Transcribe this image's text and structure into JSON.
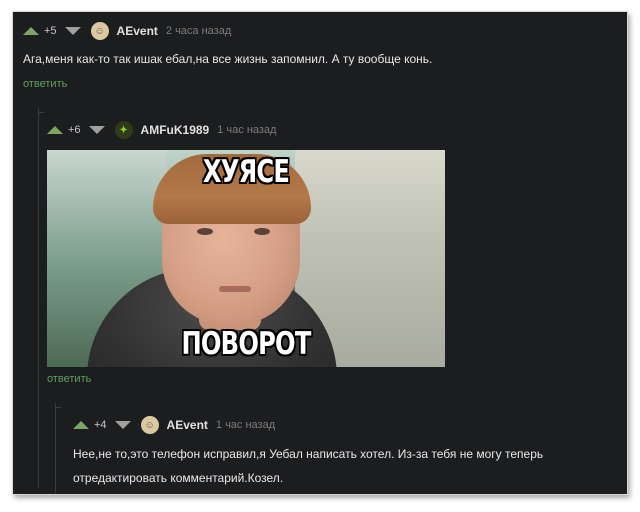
{
  "comments": [
    {
      "score": "+5",
      "author": "AEvent",
      "time": "2 часа назад",
      "text": "Ага,меня как-то так ишак ебал,на все жизнь запомнил. А ту вообще конь.",
      "reply_label": "ответить"
    },
    {
      "score": "+6",
      "author": "AMFuK1989",
      "time": "1 час назад",
      "meme": {
        "top_text": "ХУЯСЕ",
        "bottom_text": "ПОВОРОТ"
      },
      "reply_label": "ответить"
    },
    {
      "score": "+4",
      "author": "AEvent",
      "time": "1 час назад",
      "text_line1": "Нее,не то,это телефон исправил,я Уебал написать хотел. Из-за тебя не могу теперь",
      "text_line2": "отредактировать комментарий.Козел."
    }
  ],
  "colors": {
    "background": "#1c1d1f",
    "upvote": "#7ea564",
    "reply": "#5fa05f"
  },
  "icons": [
    "upvote-icon",
    "downvote-icon",
    "avatar-icon"
  ]
}
